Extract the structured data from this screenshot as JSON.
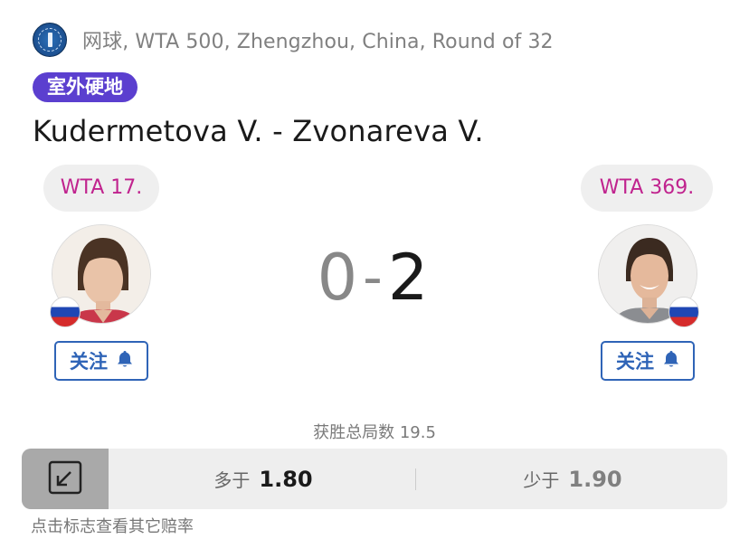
{
  "header": {
    "league_logo_icon": "league-emblem-icon",
    "breadcrumb": "网球, WTA 500, Zhengzhou, China, Round of 32"
  },
  "match": {
    "surface": "室外硬地",
    "title": "Kudermetova V. - Zvonareva V."
  },
  "home": {
    "rank": "WTA 17.",
    "flag_icon": "russia-flag-icon",
    "follow_label": "关注",
    "score": "0"
  },
  "away": {
    "rank": "WTA 369.",
    "flag_icon": "russia-flag-icon",
    "follow_label": "关注",
    "score": "2"
  },
  "score_separator": "-",
  "market": {
    "title": "获胜总局数 19.5",
    "over_label": "多于",
    "over_value": "1.80",
    "under_label": "少于",
    "under_value": "1.90",
    "external_icon": "external-link-icon"
  },
  "hint": "点击标志查看其它赔率",
  "colors": {
    "accent": "#2f64b7",
    "surface_badge": "#5b3fcf",
    "rank_text": "#c0238e"
  }
}
